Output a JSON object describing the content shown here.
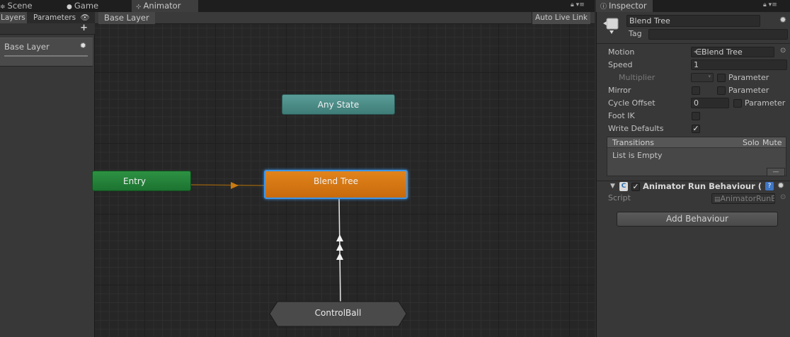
{
  "tabs": {
    "scene": "Scene",
    "game": "Game",
    "animator": "Animator",
    "inspector": "Inspector"
  },
  "left_panel": {
    "tab_layers": "Layers",
    "tab_parameters": "Parameters",
    "add": "+",
    "layer_name": "Base Layer"
  },
  "graph": {
    "breadcrumb": "Base Layer",
    "auto_live_link": "Auto Live Link",
    "nodes": {
      "any_state": "Any State",
      "entry": "Entry",
      "blend_tree": "Blend Tree",
      "control_ball": "ControlBall"
    }
  },
  "inspector": {
    "name": "Blend Tree",
    "tag_label": "Tag",
    "tag_value": "",
    "fields": {
      "motion_label": "Motion",
      "motion_value": "Blend Tree",
      "speed_label": "Speed",
      "speed_value": "1",
      "multiplier_label": "Multiplier",
      "parameter_label": "Parameter",
      "mirror_label": "Mirror",
      "cycle_offset_label": "Cycle Offset",
      "cycle_offset_value": "0",
      "foot_ik_label": "Foot IK",
      "write_defaults_label": "Write Defaults"
    },
    "transitions": {
      "header": "Transitions",
      "solo": "Solo",
      "mute": "Mute",
      "empty": "List is Empty",
      "remove": "—"
    },
    "behaviour": {
      "title": "Animator Run Behaviour (",
      "script_label": "Script",
      "script_value": "AnimatorRunBeha"
    },
    "add_behaviour": "Add Behaviour"
  },
  "colors": {
    "any_state": "#4e8d88",
    "entry": "#248a3b",
    "blend_tree": "#d97812",
    "selection": "#3f95e6"
  }
}
